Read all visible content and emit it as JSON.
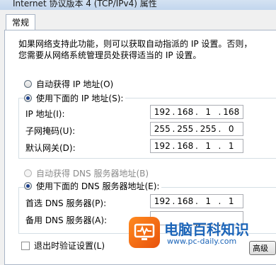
{
  "window": {
    "title": "Internet 协议版本 4 (TCP/IPv4) 属性"
  },
  "tabs": [
    {
      "label": "常规"
    }
  ],
  "description": {
    "line1": "如果网络支持此功能，则可以获取自动指派的 IP 设置。否则，",
    "line2": "您需要从网络系统管理员处获得适当的 IP 设置。"
  },
  "ip_mode": {
    "auto_label": "自动获得 IP 地址(O)",
    "manual_label": "使用下面的 IP 地址(S):",
    "selected": "manual"
  },
  "ip_fields": {
    "ip_label": "IP 地址(I):",
    "ip_value": [
      "192",
      "168",
      "1",
      "168"
    ],
    "mask_label": "子网掩码(U):",
    "mask_value": [
      "255",
      "255",
      "255",
      "0"
    ],
    "gateway_label": "默认网关(D):",
    "gateway_value": [
      "192",
      "168",
      "1",
      "1"
    ]
  },
  "dns_mode": {
    "auto_label": "自动获得 DNS 服务器地址(B)",
    "manual_label": "使用下面的 DNS 服务器地址(E):",
    "selected": "manual"
  },
  "dns_fields": {
    "preferred_label": "首选 DNS 服务器(P):",
    "preferred_value": [
      "192",
      "168",
      "1",
      "1"
    ],
    "alternate_label": "备用 DNS 服务器(A):",
    "alternate_value": [
      "",
      "",
      "",
      ""
    ]
  },
  "validate": {
    "label": "退出时验证设置(L)",
    "checked": false
  },
  "advanced_button": {
    "label": "高级(V)..."
  },
  "watermark": {
    "brand": "电脑百科知识",
    "url": "www.pc-daily.com"
  },
  "colors": {
    "selection_blue": "#1a3f8c",
    "brand_orange": "#f07a16",
    "brand_blue": "#1b64b8"
  }
}
